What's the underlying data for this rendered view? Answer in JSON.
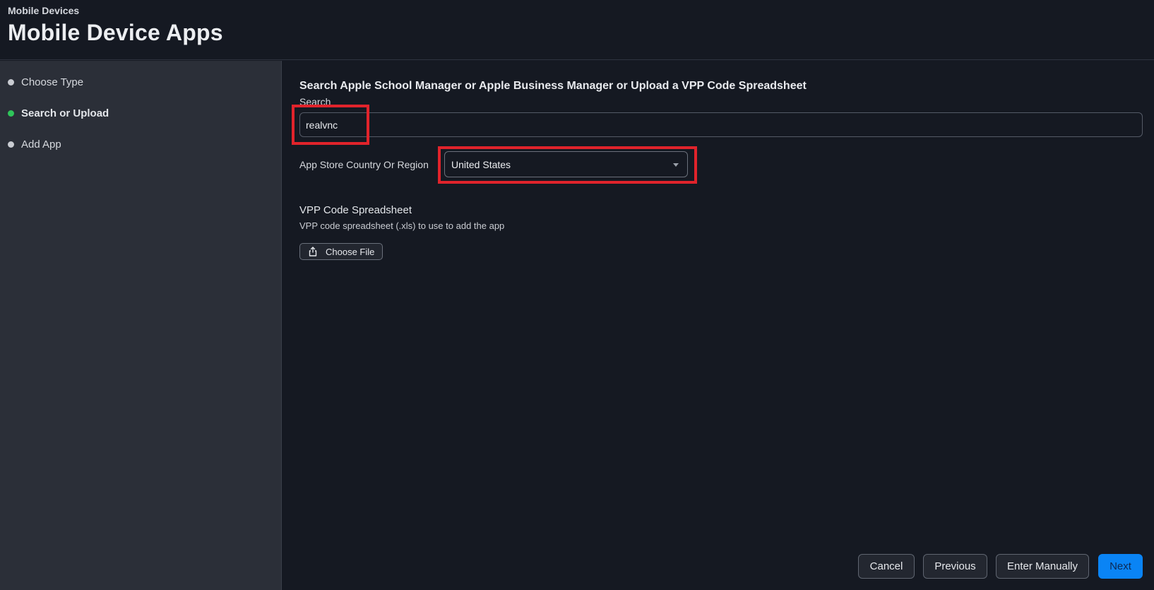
{
  "header": {
    "breadcrumb": "Mobile Devices",
    "title": "Mobile Device Apps"
  },
  "sidebar": {
    "steps": [
      {
        "label": "Choose Type",
        "active": false
      },
      {
        "label": "Search or Upload",
        "active": true
      },
      {
        "label": "Add App",
        "active": false
      }
    ]
  },
  "main": {
    "heading": "Search Apple School Manager or Apple Business Manager or Upload a VPP Code Spreadsheet",
    "search": {
      "label": "Search",
      "value": "realvnc"
    },
    "region": {
      "label": "App Store Country Or Region",
      "selected": "United States"
    },
    "vpp": {
      "title": "VPP Code Spreadsheet",
      "description": "VPP code spreadsheet (.xls) to use to add the app",
      "button_label": "Choose File"
    }
  },
  "footer": {
    "cancel": "Cancel",
    "previous": "Previous",
    "enter_manually": "Enter Manually",
    "next": "Next"
  },
  "colors": {
    "background": "#151922",
    "sidebar": "#2b2f38",
    "active_step": "#2fc55a",
    "primary": "#0a84f5",
    "highlight": "#e0232b"
  },
  "icons": {
    "choose_file": "upload-icon",
    "region_dropdown": "chevron-down-icon"
  }
}
